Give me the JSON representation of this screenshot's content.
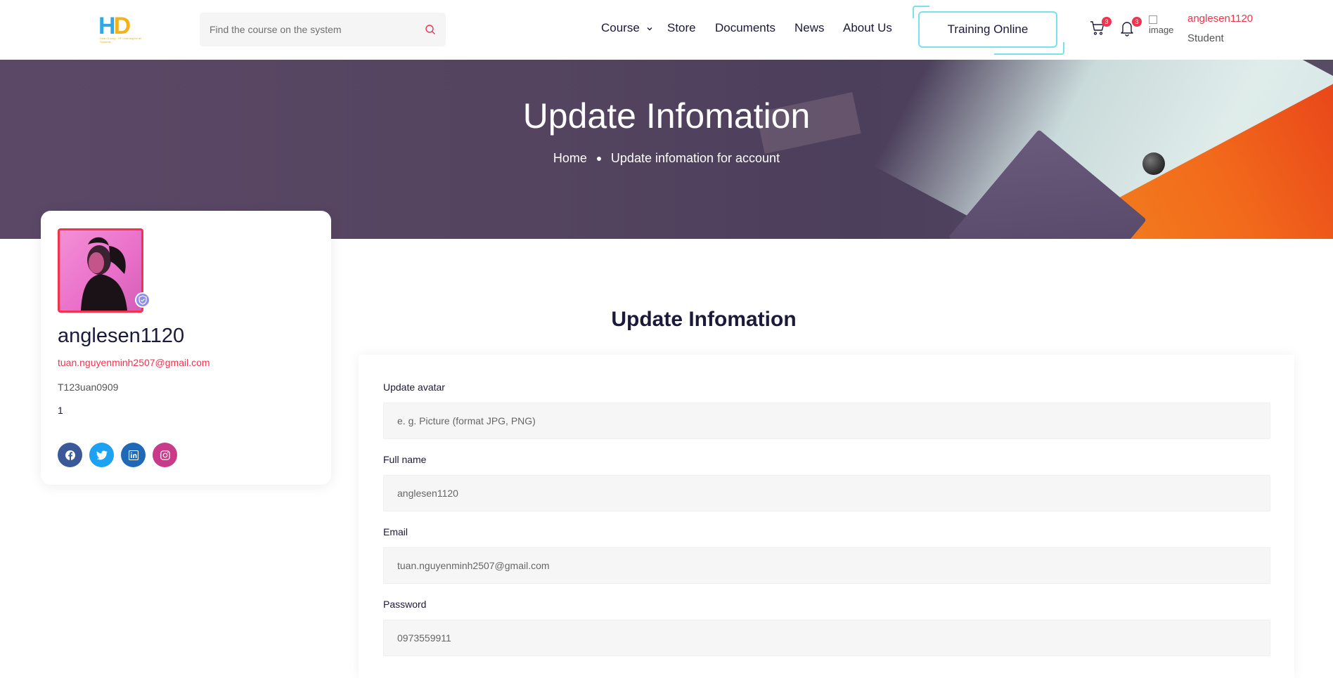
{
  "header": {
    "logo_text_1": "H",
    "logo_text_2": "D",
    "logo_tagline": "Hoan Duong · HF  Learning for all Students",
    "search_placeholder": "Find the course on the system",
    "nav": {
      "course": "Course",
      "store": "Store",
      "documents": "Documents",
      "news": "News",
      "about": "About Us"
    },
    "training_button": "Training Online",
    "cart_count": "3",
    "notify_count": "3",
    "avatar_alt": "image",
    "user_name": "anglesen1120",
    "user_role": "Student"
  },
  "banner": {
    "title": "Update Infomation",
    "breadcrumb_home": "Home",
    "breadcrumb_current": "Update infomation for account"
  },
  "profile": {
    "name": "anglesen1120",
    "email": "tuan.nguyenminh2507@gmail.com",
    "code": "T123uan0909",
    "number": "1"
  },
  "form": {
    "title": "Update Infomation",
    "avatar_label": "Update avatar",
    "avatar_placeholder": "e. g. Picture (format JPG, PNG)",
    "fullname_label": "Full name",
    "fullname_value": "anglesen1120",
    "email_label": "Email",
    "email_value": "tuan.nguyenminh2507@gmail.com",
    "password_label": "Password",
    "password_value": "0973559911"
  },
  "colors": {
    "accent": "#f0344f",
    "navy": "#1b1a3a",
    "cyan": "#79e0ee",
    "facebook": "#3b5999",
    "twitter": "#1da1f2",
    "linkedin": "#1f69b7",
    "instagram": "#c93a8a"
  }
}
